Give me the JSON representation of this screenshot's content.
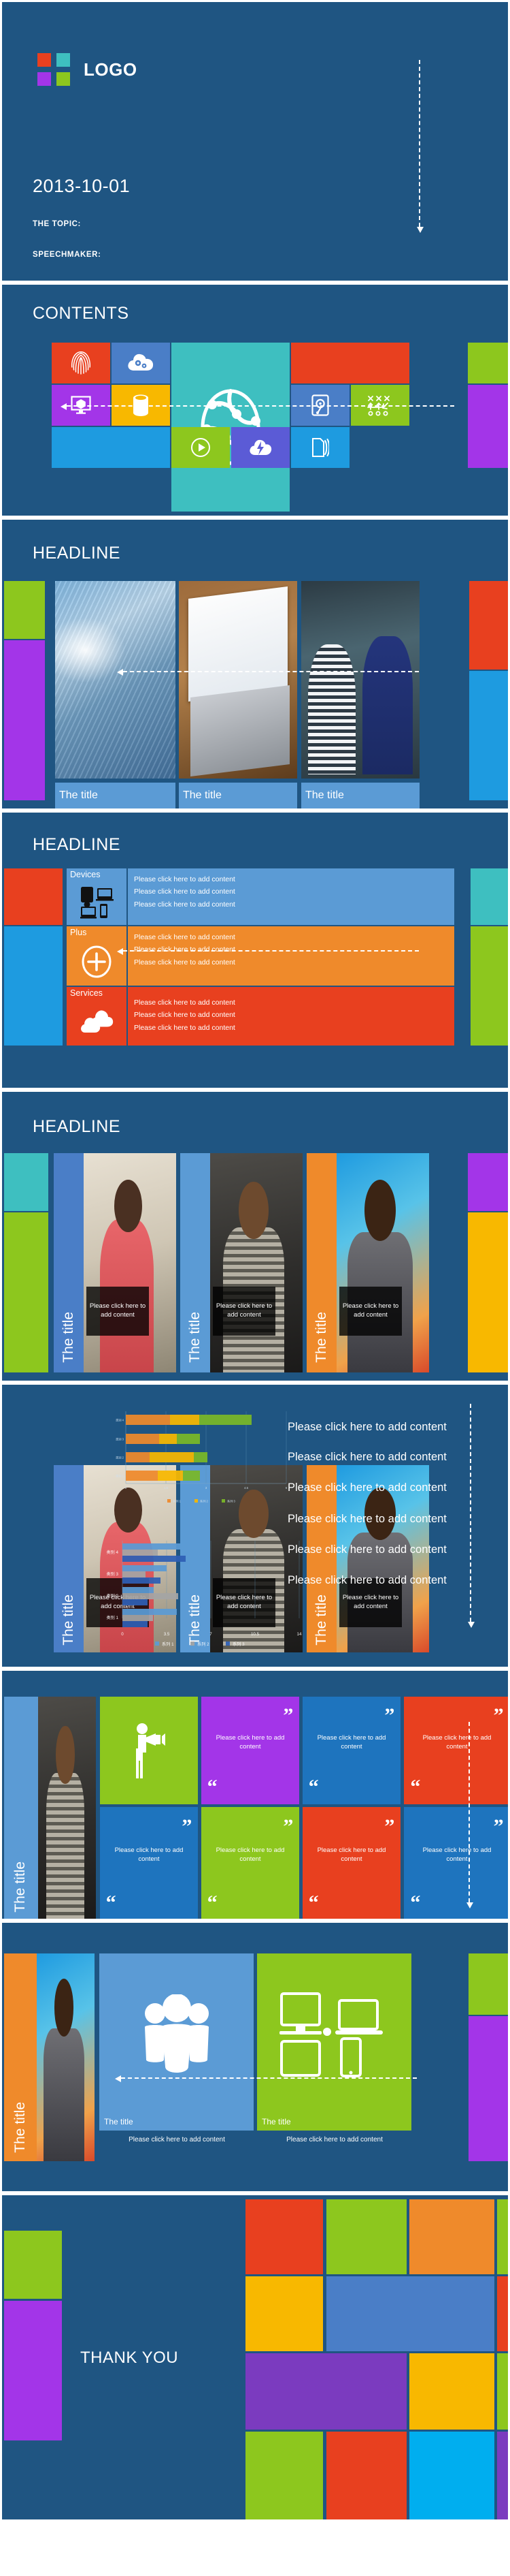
{
  "theme": {
    "bg": "#1F5582",
    "red": "#E8401F",
    "orange": "#EF8A2B",
    "yellow": "#F8B800",
    "green": "#8DC71E",
    "teal": "#3EBFC0",
    "purple": "#A335E8",
    "violet": "#7B3BBF",
    "blue": "#1E9BE0",
    "steel": "#4A7EC7",
    "lightblue": "#5B9BD5",
    "white": "#FFFFFF"
  },
  "slide_title": {
    "logo_text": "LOGO",
    "logo_squares": [
      "#E8401F",
      "#3EBFC0",
      "#A335E8",
      "#8DC71E"
    ],
    "date": "2013-10-01",
    "topic_label": "THE TOPIC:",
    "speaker_label": "SPEECHMAKER:"
  },
  "slide_contents": {
    "heading": "CONTENTS",
    "tiles": [
      {
        "name": "fingerprint-tile",
        "color": "#E8401F",
        "icon": "fingerprint-icon"
      },
      {
        "name": "cloud-settings-tile",
        "color": "#4A7EC7",
        "icon": "cloud-gears-icon"
      },
      {
        "name": "globe-network-tile",
        "color": "#3EBFC0",
        "icon": "globe-network-icon"
      },
      {
        "name": "blank-red-tile",
        "color": "#E8401F",
        "icon": "none"
      },
      {
        "name": "monitor-box-tile",
        "color": "#A335E8",
        "icon": "monitor-package-icon"
      },
      {
        "name": "database-tile",
        "color": "#F8B800",
        "icon": "database-icon"
      },
      {
        "name": "harddrive-tile",
        "color": "#4A7EC7",
        "icon": "hard-drive-icon"
      },
      {
        "name": "strategy-tile",
        "color": "#8DC71E",
        "icon": "strategy-board-icon"
      },
      {
        "name": "blank-cyan-tile",
        "color": "#1E9BE0",
        "icon": "none"
      },
      {
        "name": "play-tile",
        "color": "#8DC71E",
        "icon": "play-circle-icon"
      },
      {
        "name": "lightning-cloud-tile",
        "color": "#5B5BD6",
        "icon": "lightning-cloud-icon"
      },
      {
        "name": "documents-tile",
        "color": "#1E9BE0",
        "icon": "documents-icon"
      }
    ],
    "edge_tiles": [
      {
        "name": "edge-green",
        "color": "#8DC71E"
      },
      {
        "name": "edge-purple",
        "color": "#A335E8"
      }
    ]
  },
  "slide_headline_images": {
    "heading": "HEADLINE",
    "cards": [
      {
        "name": "card-building",
        "image": "glass-building-photo",
        "title": "The title"
      },
      {
        "name": "card-laptop",
        "image": "laptop-social-feed-photo",
        "title": "The title"
      },
      {
        "name": "card-colleagues",
        "image": "two-colleagues-tablet-photo",
        "title": "The title"
      }
    ],
    "edge_tiles": [
      {
        "name": "edge-green",
        "color": "#8DC71E"
      },
      {
        "name": "edge-purple",
        "color": "#A335E8"
      },
      {
        "name": "edge-red",
        "color": "#E8401F"
      },
      {
        "name": "edge-blue",
        "color": "#1E9BE0"
      }
    ]
  },
  "slide_rows": {
    "heading": "HEADLINE",
    "rows": [
      {
        "name": "devices-row",
        "label": "Devices",
        "icon": "devices-icon",
        "icon_color": "#5B9BD5",
        "body_color": "#5B9BD5",
        "lines": [
          "Please click here to add content",
          "Please click here to add content",
          "Please click here to add content"
        ]
      },
      {
        "name": "plus-row",
        "label": "Plus",
        "icon": "plus-circle-icon",
        "icon_color": "#EF8A2B",
        "body_color": "#EF8A2B",
        "lines": [
          "Please click here to add content",
          "Please click here to add content",
          "Please click here to add content"
        ]
      },
      {
        "name": "services-row",
        "label": "Services",
        "icon": "clouds-icon",
        "icon_color": "#E8401F",
        "body_color": "#E8401F",
        "lines": [
          "Please click here to add content",
          "Please click here to add content",
          "Please click here to add content"
        ]
      }
    ],
    "edge_tiles": [
      {
        "name": "edge-red",
        "color": "#E8401F"
      },
      {
        "name": "edge-blue",
        "color": "#1E9BE0"
      },
      {
        "name": "edge-teal",
        "color": "#3EBFC0"
      },
      {
        "name": "edge-green",
        "color": "#8DC71E"
      }
    ]
  },
  "slide_people": {
    "heading": "HEADLINE",
    "cards": [
      {
        "name": "person-card-1",
        "accent": "#4A7EC7",
        "image": "woman-red-blazer-photo",
        "vtitle": "The title",
        "caption": "Please click here to add content"
      },
      {
        "name": "person-card-2",
        "accent": "#5B9BD5",
        "image": "man-striped-shirt-photo",
        "vtitle": "The title",
        "caption": "Please click here to add content"
      },
      {
        "name": "person-card-3",
        "accent": "#EF8A2B",
        "image": "man-glasses-photo",
        "vtitle": "The title",
        "caption": "Please click here to add content"
      }
    ],
    "edge_tiles": [
      {
        "name": "edge-teal",
        "color": "#3EBFC0"
      },
      {
        "name": "edge-green",
        "color": "#8DC71E"
      },
      {
        "name": "edge-purple",
        "color": "#A335E8"
      },
      {
        "name": "edge-yellow",
        "color": "#F8B800"
      }
    ]
  },
  "slide_chart": {
    "bullets": [
      "Please click here to add content",
      "Please click here to add content",
      "Please click here to add content",
      "Please click here to add content",
      "Please click here to add content",
      "Please click here to add content"
    ],
    "cards": [
      {
        "name": "person-card-1",
        "accent": "#4A7EC7",
        "vtitle": "The title",
        "caption": "Please click here to add content"
      },
      {
        "name": "person-card-2",
        "accent": "#5B9BD5",
        "vtitle": "The title",
        "caption": "Please click here to add content"
      },
      {
        "name": "person-card-3",
        "accent": "#EF8A2B",
        "vtitle": "The title",
        "caption": "Please click here to add content"
      }
    ]
  },
  "chart_data": [
    {
      "type": "bar",
      "orientation": "horizontal",
      "stacked": true,
      "title": "",
      "xlabel": "",
      "ylabel": "",
      "categories": [
        "类别 1",
        "类别 2",
        "类别 3",
        "类别 4"
      ],
      "series": [
        {
          "name": "系列 1",
          "color": "#EF8A2B",
          "values": [
            2.4,
            2.0,
            2.5,
            3.3
          ]
        },
        {
          "name": "系列 2",
          "color": "#F8B800",
          "values": [
            1.2,
            2.7,
            1.4,
            1.8
          ]
        },
        {
          "name": "系列 3",
          "color": "#7AB828",
          "values": [
            1.0,
            0.8,
            1.4,
            2.9
          ]
        }
      ],
      "xticks": [
        0,
        1.5,
        3,
        4.5,
        6
      ],
      "xtick_labels": [
        "0",
        "1.5",
        "3",
        "4.5",
        "6"
      ],
      "xlim": [
        0,
        6
      ],
      "grid": true,
      "legend_position": "bottom"
    },
    {
      "type": "bar",
      "orientation": "horizontal",
      "stacked": false,
      "title": "",
      "xlabel": "",
      "ylabel": "",
      "categories": [
        "类别 1",
        "类别 2",
        "类别 3",
        "类别 4"
      ],
      "series": [
        {
          "name": "系列 1",
          "color": "#5B9BD5",
          "values": [
            4.3,
            2.5,
            3.5,
            4.5
          ]
        },
        {
          "name": "系列 2",
          "color": "#A5A5A5",
          "values": [
            2.4,
            4.4,
            1.8,
            2.8
          ]
        },
        {
          "name": "系列 3",
          "color": "#2E5FB5",
          "values": [
            2.0,
            2.0,
            3.0,
            5.0
          ]
        }
      ],
      "xticks": [
        0,
        3.5,
        7,
        10.5,
        14
      ],
      "xtick_labels": [
        "0",
        "3.5",
        "7",
        "10.5",
        "14"
      ],
      "xlim": [
        0,
        14
      ],
      "grid": true,
      "legend_position": "bottom"
    }
  ],
  "slide_quotes": {
    "side_card": {
      "name": "person-side-card",
      "vtitle": "The title",
      "accent": "#5B9BD5"
    },
    "tiles": [
      {
        "name": "megaphone-tile",
        "color": "#8DC71E",
        "icon": "megaphone-person-icon",
        "text": ""
      },
      {
        "name": "quote-tile-1",
        "color": "#A335E8",
        "icon": "quote-icon",
        "text": "Please click here to add content"
      },
      {
        "name": "quote-tile-2",
        "color": "#1E74BE",
        "icon": "quote-icon",
        "text": "Please click here to add content"
      },
      {
        "name": "quote-tile-3",
        "color": "#E8401F",
        "icon": "quote-icon",
        "text": "Please click here to add content"
      },
      {
        "name": "quote-tile-4",
        "color": "#1E74BE",
        "icon": "quote-icon",
        "text": "Please click here to add content"
      },
      {
        "name": "quote-tile-5",
        "color": "#8DC71E",
        "icon": "quote-icon",
        "text": "Please click here to add content"
      },
      {
        "name": "quote-tile-6",
        "color": "#E8401F",
        "icon": "quote-icon",
        "text": "Please click here to add content"
      },
      {
        "name": "quote-tile-7",
        "color": "#1E74BE",
        "icon": "quote-icon",
        "text": "Please click here to add content"
      }
    ]
  },
  "slide_devices": {
    "side_card": {
      "name": "person-side-card",
      "vtitle": "The title",
      "accent": "#EF8A2B"
    },
    "tiles": [
      {
        "name": "audience-tile",
        "color": "#5B9BD5",
        "icon": "people-group-icon",
        "title": "The title",
        "caption": "Please click here to add content"
      },
      {
        "name": "devices-tile",
        "color": "#8DC71E",
        "icon": "multi-devices-icon",
        "title": "The title",
        "caption": "Please click here to add content"
      }
    ],
    "edge_tiles": [
      {
        "name": "edge-green",
        "color": "#8DC71E"
      },
      {
        "name": "edge-purple",
        "color": "#A335E8"
      }
    ]
  },
  "slide_thanks": {
    "text": "THANK YOU",
    "left_tiles": [
      {
        "name": "left-green",
        "color": "#8DC71E"
      },
      {
        "name": "left-purple",
        "color": "#A335E8"
      }
    ],
    "grid_tiles": [
      {
        "name": "tile-red",
        "color": "#E8401F"
      },
      {
        "name": "tile-green",
        "color": "#8DC71E"
      },
      {
        "name": "tile-orange",
        "color": "#EF8A2B"
      },
      {
        "name": "tile-green-2",
        "color": "#8DC71E"
      },
      {
        "name": "tile-yellow",
        "color": "#F8B800"
      },
      {
        "name": "tile-steel",
        "color": "#4A7EC7"
      },
      {
        "name": "tile-red-2",
        "color": "#E8401F"
      },
      {
        "name": "tile-violet",
        "color": "#7B3BBF"
      },
      {
        "name": "tile-yellow-2",
        "color": "#F8B800"
      },
      {
        "name": "tile-green-3",
        "color": "#8DC71E"
      },
      {
        "name": "tile-green-4",
        "color": "#8DC71E"
      },
      {
        "name": "tile-red-3",
        "color": "#E8401F"
      },
      {
        "name": "tile-cyan",
        "color": "#00AEEF"
      },
      {
        "name": "tile-violet-2",
        "color": "#7B3BBF"
      }
    ]
  }
}
